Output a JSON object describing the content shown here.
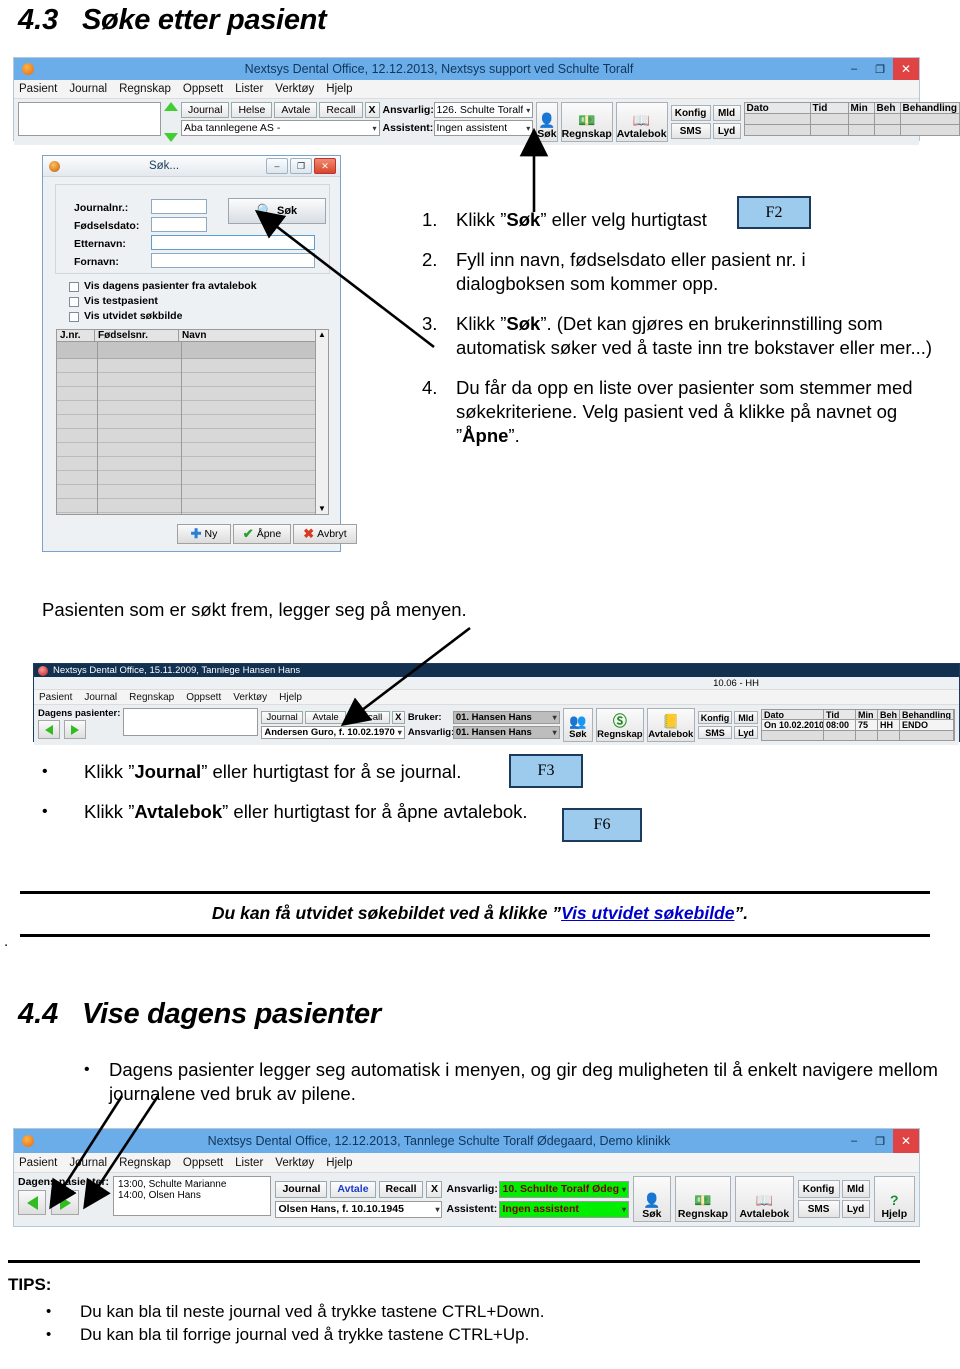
{
  "sections": {
    "s43_num": "4.3",
    "s43_title": "Søke etter pasient",
    "s44_num": "4.4",
    "s44_title": "Vise dagens pasienter"
  },
  "colors": {
    "title_bar": "#6aade9",
    "keycap_fill": "#9dcbee",
    "keycap_border": "#1b3a5c",
    "close_button": "#e04343",
    "link_blue": "#0000cc",
    "green_highlight": "#00ee00"
  },
  "main_window": {
    "title": "Nextsys Dental Office,  12.12.2013, Nextsys support ved Schulte Toralf",
    "window_buttons": {
      "minimize": "–",
      "maximize": "❐",
      "close": "✕"
    },
    "menu": [
      "Pasient",
      "Journal",
      "Regnskap",
      "Oppsett",
      "Lister",
      "Verktøy",
      "Hjelp"
    ],
    "patient_field_value": "",
    "tabs": [
      "Journal",
      "Helse",
      "Avtale",
      "Recall"
    ],
    "close_tab_label": "X",
    "clinic_combo": "Aba tannlegene AS -",
    "ansvarlig_label": "Ansvarlig:",
    "ansvarlig_value": "126. Schulte Toralf",
    "assistent_label": "Assistent:",
    "assistent_value": "Ingen assistent",
    "toolbar": [
      {
        "icon": "search-person-icon",
        "label": "Søk"
      },
      {
        "icon": "money-icon",
        "label": "Regnskap"
      },
      {
        "icon": "book-icon",
        "label": "Avtalebok"
      }
    ],
    "mini_buttons": [
      "Konfig",
      "Mld",
      "SMS",
      "Lyd"
    ],
    "grid_headers": [
      "Dato",
      "Tid",
      "Min",
      "Beh",
      "Behandling"
    ],
    "grid_rows": [
      [
        "",
        "",
        "",
        "",
        ""
      ],
      [
        "",
        "",
        "",
        "",
        ""
      ]
    ]
  },
  "search_dialog": {
    "title": "Søk...",
    "window_buttons": {
      "minimize": "–",
      "maximize": "❐",
      "close": "✕"
    },
    "fields": [
      {
        "label": "Journalnr.:",
        "value": ""
      },
      {
        "label": "Fødselsdato:",
        "value": ""
      },
      {
        "label": "Etternavn:",
        "value": ""
      },
      {
        "label": "Fornavn:",
        "value": ""
      }
    ],
    "search_button": {
      "label": "Søk",
      "icon": "magnifier-icon"
    },
    "checkboxes": [
      {
        "label": "Vis dagens pasienter fra avtalebok",
        "checked": false
      },
      {
        "label": "Vis testpasient",
        "checked": false
      },
      {
        "label": "Vis utvidet søkbilde",
        "checked": false
      }
    ],
    "list_headers": [
      "J.nr.",
      "Fødselsnr.",
      "Navn"
    ],
    "buttons": [
      {
        "label": "Ny",
        "icon": "plus-icon"
      },
      {
        "label": "Åpne",
        "icon": "check-icon"
      },
      {
        "label": "Avbryt",
        "icon": "cross-icon"
      }
    ]
  },
  "steps": [
    {
      "n": "1.",
      "parts": [
        {
          "t": "Klikk ”",
          "b": false
        },
        {
          "t": "Søk",
          "b": true
        },
        {
          "t": "” eller velg hurtigtast ",
          "b": false
        }
      ],
      "keycap": "F2"
    },
    {
      "n": "2.",
      "parts": [
        {
          "t": "Fyll inn navn, fødselsdato eller pasient nr. i dialogboksen som kommer opp.",
          "b": false
        }
      ],
      "keycap": ""
    },
    {
      "n": "3.",
      "parts": [
        {
          "t": "Klikk ”",
          "b": false
        },
        {
          "t": "Søk",
          "b": true
        },
        {
          "t": "”. (Det kan gjøres en brukerinnstilling som automatisk søker ved å taste inn tre bokstaver eller mer...)",
          "b": false
        }
      ],
      "keycap": ""
    },
    {
      "n": "4.",
      "parts": [
        {
          "t": "Du får da opp en liste over pasienter som stemmer med søkekriteriene. Velg pasient ved å klikke på navnet og  ”",
          "b": false
        },
        {
          "t": "Åpne",
          "b": true
        },
        {
          "t": "”.",
          "b": false
        }
      ],
      "keycap": ""
    }
  ],
  "paragraph_patient_menu": "Pasienten som er søkt frem, legger seg på menyen.",
  "second_window": {
    "title": "Nextsys Dental Office,  15.11.2009, Tannlege Hansen Hans",
    "status_right": "10.06 - HH",
    "menu": [
      "Pasient",
      "Journal",
      "Regnskap",
      "Oppsett",
      "Verktøy",
      "Hjelp"
    ],
    "dagens_label": "Dagens pasienter:",
    "nav_prev_icon": "arrow-left-icon",
    "nav_next_icon": "arrow-right-icon",
    "list_value": "",
    "tabs": [
      "Journal",
      "Avtale",
      "Recall"
    ],
    "close_tab_label": "X",
    "patient_combo": "Andersen Guro, f. 10.02.1970",
    "bruker_label": "Bruker:",
    "bruker_value": "01. Hansen Hans",
    "ansvarlig_label": "Ansvarlig:",
    "ansvarlig_value": "01. Hansen Hans",
    "toolbar": [
      {
        "icon": "search-person-icon",
        "label": "Søk"
      },
      {
        "icon": "money-icon",
        "label": "Regnskap"
      },
      {
        "icon": "book-icon",
        "label": "Avtalebok"
      }
    ],
    "mini_buttons": [
      "Konfig",
      "Mld",
      "SMS",
      "Lyd"
    ],
    "grid_headers": [
      "Dato",
      "Tid",
      "Min",
      "Beh",
      "Behandling"
    ],
    "grid_rows": [
      [
        "On 10.02.2010",
        "08:00",
        "75",
        "HH",
        "ENDO"
      ],
      [
        "",
        "",
        "",
        "",
        ""
      ]
    ]
  },
  "bullets_mid": [
    {
      "parts": [
        {
          "t": "Klikk ”",
          "b": false
        },
        {
          "t": "Journal",
          "b": true
        },
        {
          "t": "” eller hurtigtast for å se journal.",
          "b": false
        }
      ],
      "keycap": "F3"
    },
    {
      "parts": [
        {
          "t": "Klikk ”",
          "b": false
        },
        {
          "t": "Avtalebok",
          "b": true
        },
        {
          "t": "” eller hurtigtast for å åpne avtalebok.",
          "b": false
        }
      ],
      "keycap": "F6"
    }
  ],
  "callout": {
    "before": "Du kan få utvidet søkebildet ved å klikke ”",
    "link": "Vis utvidet søkebilde",
    "after": "”."
  },
  "stray_period": ".",
  "s44_bullet": "Dagens pasienter legger seg automatisk i menyen, og gir deg muligheten til å enkelt navigere mellom journalene ved bruk av pilene.",
  "third_window": {
    "title": "Nextsys Dental Office,  12.12.2013, Tannlege Schulte Toralf Ødegaard, Demo klinikk",
    "window_buttons": {
      "minimize": "–",
      "maximize": "❐",
      "close": "✕"
    },
    "menu": [
      "Pasient",
      "Journal",
      "Regnskap",
      "Oppsett",
      "Lister",
      "Verktøy",
      "Hjelp"
    ],
    "dagens_label": "Dagens pasienter:",
    "nav_prev_icon": "arrow-left-icon",
    "nav_next_icon": "arrow-right-icon",
    "patient_list": [
      "13:00, Schulte Marianne",
      "14:00, Olsen Hans"
    ],
    "tabs": [
      "Journal",
      "Avtale",
      "Recall"
    ],
    "close_tab_label": "X",
    "patient_combo": "Olsen Hans, f. 10.10.1945",
    "ansvarlig_label": "Ansvarlig:",
    "ansvarlig_value": "10. Schulte Toralf Ødeg",
    "assistent_label": "Assistent:",
    "assistent_value": "Ingen assistent",
    "toolbar": [
      {
        "icon": "search-person-icon",
        "label": "Søk"
      },
      {
        "icon": "money-icon",
        "label": "Regnskap"
      },
      {
        "icon": "book-icon",
        "label": "Avtalebok"
      }
    ],
    "mini_buttons": [
      "Konfig",
      "Mld",
      "SMS",
      "Lyd"
    ],
    "help_button": {
      "label": "Hjelp",
      "icon": "help-icon"
    }
  },
  "tips": {
    "heading": "TIPS:",
    "items": [
      "Du kan bla til neste journal ved å trykke tastene CTRL+Down.",
      "Du kan bla til forrige journal ved å trykke tastene CTRL+Up."
    ]
  }
}
